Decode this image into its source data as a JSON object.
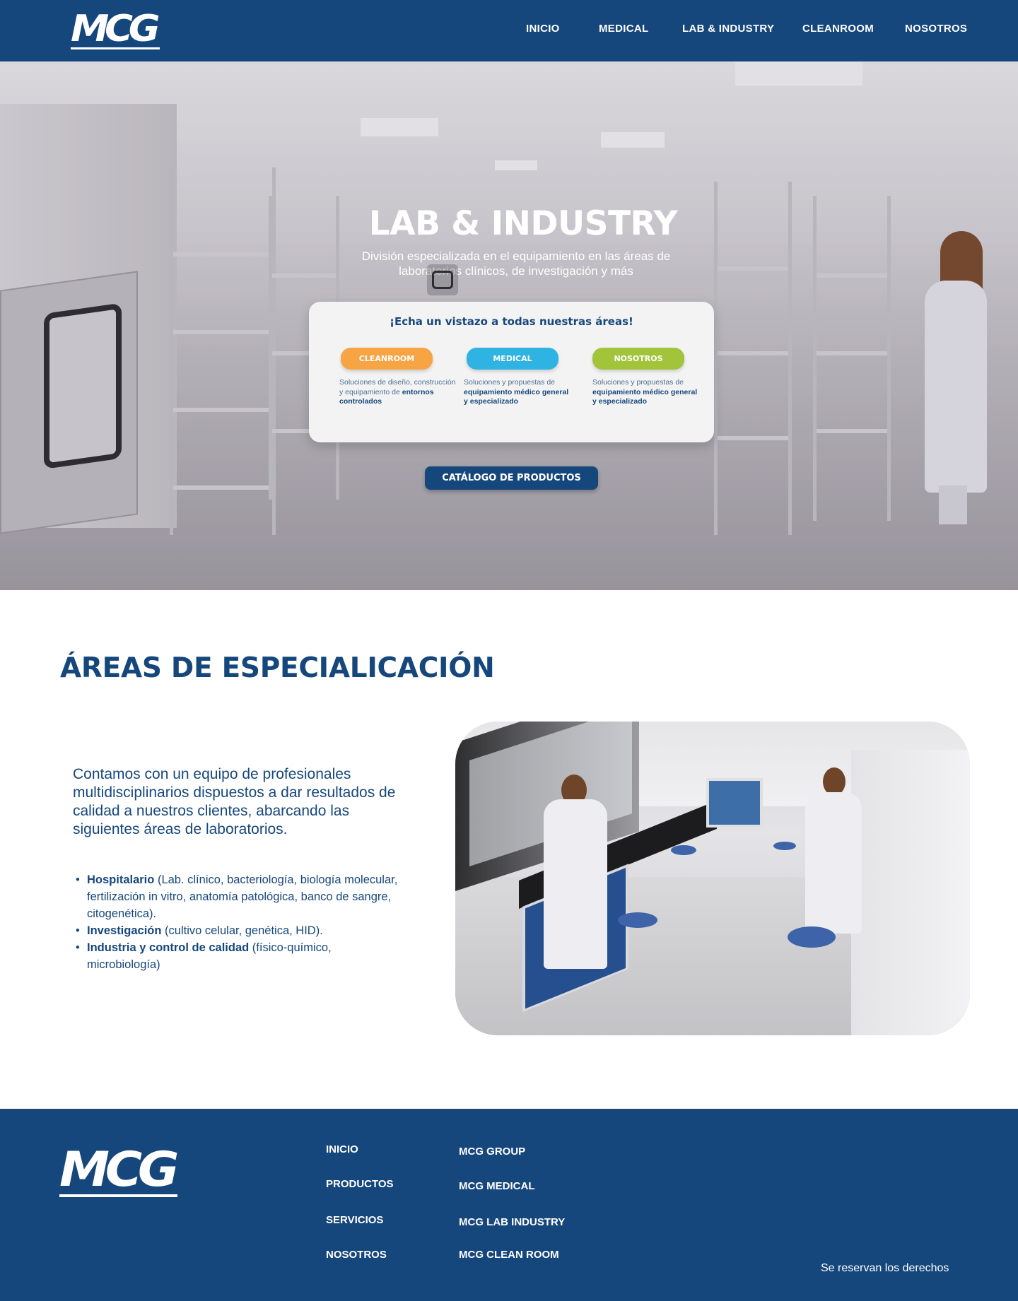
{
  "header": {
    "logo_text": "MCG",
    "nav": [
      "INICIO",
      "MEDICAL",
      "LAB & INDUSTRY",
      "CLEANROOM",
      "NOSOTROS"
    ]
  },
  "hero": {
    "title": "LAB & INDUSTRY",
    "subtitle": "División especializada en el equipamiento en las áreas de laboratorios clínicos, de investigación y más",
    "card_title": "¡Echa un vistazo a todas nuestras áreas!",
    "areas": [
      {
        "button": "CLEANROOM",
        "desc_plain": "Soluciones de diseño, construcción y equipamiento de ",
        "desc_bold": "entornos controlados",
        "color": "#f7a444"
      },
      {
        "button": "MEDICAL",
        "desc_plain": "Soluciones y propuestas de ",
        "desc_bold": "equipamiento médico general y especializado",
        "color": "#2fb3e3"
      },
      {
        "button": "NOSOTROS",
        "desc_plain": "Soluciones y propuestas de ",
        "desc_bold": "equipamiento médico general y especializado",
        "color": "#a2c43a"
      }
    ],
    "catalog_button": "CATÁLOGO DE PRODUCTOS"
  },
  "specialization": {
    "title": "ÁREAS DE ESPECIALICACIÓN",
    "intro": "Contamos con un equipo de profesionales multidisciplinarios dispuestos a dar resultados de calidad a nuestros clientes, abarcando las siguientes áreas de laboratorios.",
    "items": [
      {
        "bold": "Hospitalario",
        "text": " (Lab. clínico, bacteriología, biología molecular, fertilización in vitro, anatomía patológica, banco de sangre, citogenética)."
      },
      {
        "bold": "Investigación",
        "text": " (cultivo celular, genética, HID)."
      },
      {
        "bold": "Industria y control de calidad",
        "text": " (físico-químico, microbiología)"
      }
    ]
  },
  "footer": {
    "logo_text": "MCG",
    "links_left": [
      "INICIO",
      "PRODUCTOS",
      "SERVICIOS",
      "NOSOTROS"
    ],
    "links_right": [
      "MCG GROUP",
      "MCG MEDICAL",
      "MCG LAB INDUSTRY",
      "MCG CLEAN ROOM"
    ],
    "rights": "Se reservan los derechos"
  },
  "colors": {
    "brand_navy": "#16477c",
    "cleanroom_orange": "#f7a444",
    "medical_blue": "#2fb3e3",
    "nosotros_green": "#a2c43a"
  }
}
